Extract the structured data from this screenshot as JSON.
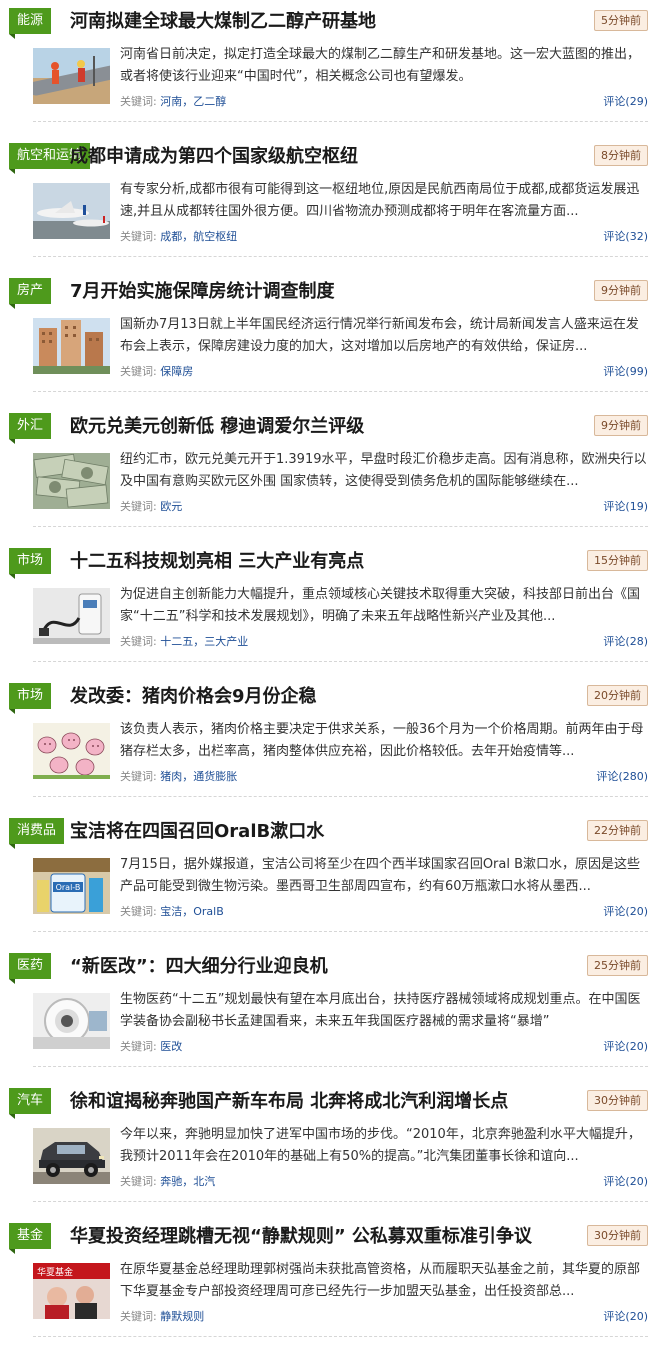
{
  "kw_label": "关键词:",
  "items": [
    {
      "category": "能源",
      "title": "河南拟建全球最大煤制乙二醇产研基地",
      "time": "5分钟前",
      "summary": "河南省日前决定，拟定打造全球最大的煤制乙二醇生产和研发基地。这一宏大蓝图的推出，或者将使该行业迎来“中国时代”，相关概念公司也有望爆发。",
      "keywords": [
        "河南",
        "乙二醇"
      ],
      "comments": "评论(29)",
      "thumb": "workers-pipe"
    },
    {
      "category": "航空和运输",
      "title": "成都申请成为第四个国家级航空枢纽",
      "time": "8分钟前",
      "summary": "有专家分析,成都市很有可能得到这一枢纽地位,原因是民航西南局位于成都,成都货运发展迅速,并且从成都转往国外很方便。四川省物流办预测成都将于明年在客流量方面...",
      "keywords": [
        "成都",
        "航空枢纽"
      ],
      "comments": "评论(32)",
      "thumb": "airplanes"
    },
    {
      "category": "房产",
      "title": "7月开始实施保障房统计调查制度",
      "time": "9分钟前",
      "summary": "国新办7月13日就上半年国民经济运行情况举行新闻发布会，统计局新闻发言人盛来运在发布会上表示，保障房建设力度的加大，这对增加以后房地产的有效供给，保证房...",
      "keywords": [
        "保障房"
      ],
      "comments": "评论(99)",
      "thumb": "buildings"
    },
    {
      "category": "外汇",
      "title": "欧元兑美元创新低 穆迪调爱尔兰评级",
      "time": "9分钟前",
      "summary": "纽约汇市，欧元兑美元开于1.3919水平，早盘时段汇价稳步走高。因有消息称，欧洲央行以及中国有意购买欧元区外围 国家债转，这使得受到债务危机的国际能够继续在...",
      "keywords": [
        "欧元"
      ],
      "comments": "评论(19)",
      "thumb": "dollars"
    },
    {
      "category": "市场",
      "title": "十二五科技规划亮相 三大产业有亮点",
      "time": "15分钟前",
      "summary": "为促进自主创新能力大幅提升，重点领域核心关键技术取得重大突破，科技部日前出台《国家“十二五”科学和技术发展规划》，明确了未来五年战略性新兴产业及其他...",
      "keywords": [
        "十二五",
        "三大产业"
      ],
      "comments": "评论(28)",
      "thumb": "charger"
    },
    {
      "category": "市场",
      "title": "发改委：猪肉价格会9月份企稳",
      "time": "20分钟前",
      "summary": "该负责人表示，猪肉价格主要决定于供求关系，一般36个月为一个价格周期。前两年由于母猪存栏太多，出栏率高，猪肉整体供应充裕，因此价格较低。去年开始疫情等...",
      "keywords": [
        "猪肉",
        "通货膨胀"
      ],
      "comments": "评论(280)",
      "thumb": "pigs"
    },
    {
      "category": "消费品",
      "title": "宝洁将在四国召回OralB漱口水",
      "time": "22分钟前",
      "summary": "7月15日，据外媒报道，宝洁公司将至少在四个西半球国家召回Oral B漱口水，原因是这些产品可能受到微生物污染。墨西哥卫生部周四宣布，约有60万瓶漱口水将从墨西...",
      "keywords": [
        "宝洁",
        "OralB"
      ],
      "comments": "评论(20)",
      "thumb": "oralb"
    },
    {
      "category": "医药",
      "title": "“新医改”：四大细分行业迎良机",
      "time": "25分钟前",
      "summary": "生物医药“十二五”规划最快有望在本月底出台，扶持医疗器械领域将成规划重点。在中国医学装备协会副秘书长孟建国看来，未来五年我国医疗器械的需求量将“暴增”",
      "keywords": [
        "医改"
      ],
      "comments": "评论(20)",
      "thumb": "scanner"
    },
    {
      "category": "汽车",
      "title": "徐和谊揭秘奔驰国产新车布局 北奔将成北汽利润增长点",
      "time": "30分钟前",
      "summary": "今年以来，奔驰明显加快了进军中国市场的步伐。“2010年，北京奔驰盈利水平大幅提升，我预计2011年会在2010年的基础上有50%的提高。”北汽集团董事长徐和谊向...",
      "keywords": [
        "奔驰",
        "北汽"
      ],
      "comments": "评论(20)",
      "thumb": "suv"
    },
    {
      "category": "基金",
      "title": "华夏投资经理跳槽无视“静默规则” 公私募双重标准引争议",
      "time": "30分钟前",
      "summary": " 在原华夏基金总经理助理郭树强尚未获批高管资格，从而履职天弘基金之前，其华夏的原部下华夏基金专户部投资经理周可彦已经先行一步加盟天弘基金，出任投资部总...",
      "keywords": [
        "静默规则"
      ],
      "comments": "评论(20)",
      "thumb": "fund"
    }
  ]
}
